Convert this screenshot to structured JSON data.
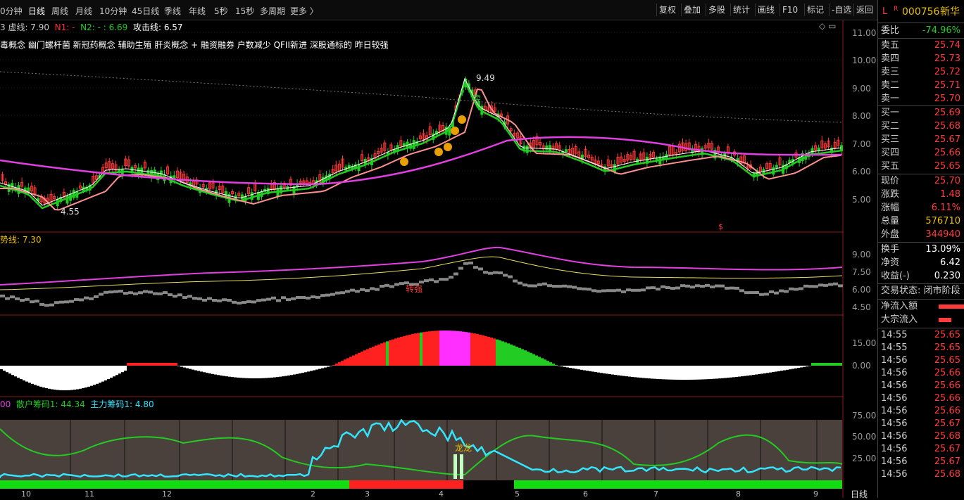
{
  "toolbar": {
    "tabs": [
      "0分钟",
      "日线",
      "周线",
      "月线",
      "10分钟",
      "45日线",
      "季线",
      "年线",
      "5秒",
      "15秒",
      "多周期",
      "更多 〉"
    ],
    "active_tab": "日线",
    "buttons": [
      "复权",
      "叠加",
      "多股",
      "统计",
      "画线",
      "F10",
      "标记",
      "-自选",
      "返回"
    ]
  },
  "stock": {
    "flag": "L",
    "r": "R",
    "code": "000756",
    "name": "新华"
  },
  "panel1": {
    "legend": [
      {
        "label": "3 虚线: 7.90",
        "color": "#c8c8c8"
      },
      {
        "label": "N1: -",
        "color": "#ff3030"
      },
      {
        "label": "N2: - : 6.69",
        "color": "#22cc22"
      },
      {
        "label": "攻击线: 6.57",
        "color": "#ffffff"
      }
    ],
    "concepts": "毒概念 幽门螺杆菌 新冠药概念 辅助生殖 肝炎概念 + 融资融券 户数减少 QFII新进 深股通标的 昨日较强",
    "high_label": "9.49",
    "low_label": "4.55",
    "sell_label": "卖",
    "axis": [
      "11.00",
      "10.00",
      "9.00",
      "8.00",
      "7.00",
      "6.00",
      "5.00"
    ],
    "marker": "$"
  },
  "panel2": {
    "legend": "势线: 7.30",
    "label": "转强",
    "axis": [
      "9.00",
      "7.50",
      "6.00",
      "4.50"
    ]
  },
  "panel3": {
    "axis": [
      "15.00",
      "0.00"
    ]
  },
  "panel4": {
    "legend_left": "00",
    "legend_retail": "散户筹码1: 44.34",
    "legend_main": "主力筹码1: 4.80",
    "label": "龙龙",
    "axis": [
      "75.00",
      "50.00",
      "25.00"
    ]
  },
  "x_axis": [
    "10",
    "11",
    "12",
    "2",
    "3",
    "4",
    "5",
    "6",
    "7",
    "8",
    "9"
  ],
  "corner_label": "日线",
  "quote": {
    "weibi": {
      "label": "委比",
      "value": "-74.96%"
    },
    "asks": [
      {
        "label": "卖五",
        "price": "25.74"
      },
      {
        "label": "卖四",
        "price": "25.73"
      },
      {
        "label": "卖三",
        "price": "25.72"
      },
      {
        "label": "卖二",
        "price": "25.71"
      },
      {
        "label": "卖一",
        "price": "25.70"
      }
    ],
    "bids": [
      {
        "label": "买一",
        "price": "25.69"
      },
      {
        "label": "买二",
        "price": "25.68"
      },
      {
        "label": "买三",
        "price": "25.67"
      },
      {
        "label": "买四",
        "price": "25.66"
      },
      {
        "label": "买五",
        "price": "25.65"
      }
    ],
    "stats": [
      {
        "label": "现价",
        "value": "25.70",
        "color": "#ff3b3b"
      },
      {
        "label": "涨跌",
        "value": "1.48",
        "color": "#ff3b3b"
      },
      {
        "label": "涨幅",
        "value": "6.11%",
        "color": "#ff3b3b"
      },
      {
        "label": "总量",
        "value": "576710",
        "color": "#e8c000"
      },
      {
        "label": "外盘",
        "value": "344940",
        "color": "#ff3b3b"
      }
    ],
    "stats2": [
      {
        "label": "换手",
        "value": "13.09%",
        "color": "#ffffff"
      },
      {
        "label": "净资",
        "value": "6.42",
        "color": "#ffffff"
      },
      {
        "label": "收益(-)",
        "value": "0.230",
        "color": "#ffffff"
      }
    ],
    "trade_status": "交易状态: 闭市阶段",
    "net_inflow": "净流入额",
    "block_inflow": "大宗流入",
    "ticks": [
      {
        "time": "14:55",
        "price": "25.65"
      },
      {
        "time": "14:55",
        "price": "25.65"
      },
      {
        "time": "14:56",
        "price": "25.65"
      },
      {
        "time": "14:56",
        "price": "25.66"
      },
      {
        "time": "14:56",
        "price": "25.66"
      },
      {
        "time": "14:56",
        "price": "25.66"
      },
      {
        "time": "14:56",
        "price": "25.66"
      },
      {
        "time": "14:56",
        "price": "25.67"
      },
      {
        "time": "14:56",
        "price": "25.68"
      },
      {
        "time": "14:56",
        "price": "25.67"
      },
      {
        "time": "14:56",
        "price": "25.67"
      },
      {
        "time": "14:56",
        "price": "25.68"
      }
    ]
  },
  "colors": {
    "up": "#ff3b3b",
    "down": "#22cc22",
    "ma": "#e040e0",
    "cyan": "#33e6ff"
  }
}
